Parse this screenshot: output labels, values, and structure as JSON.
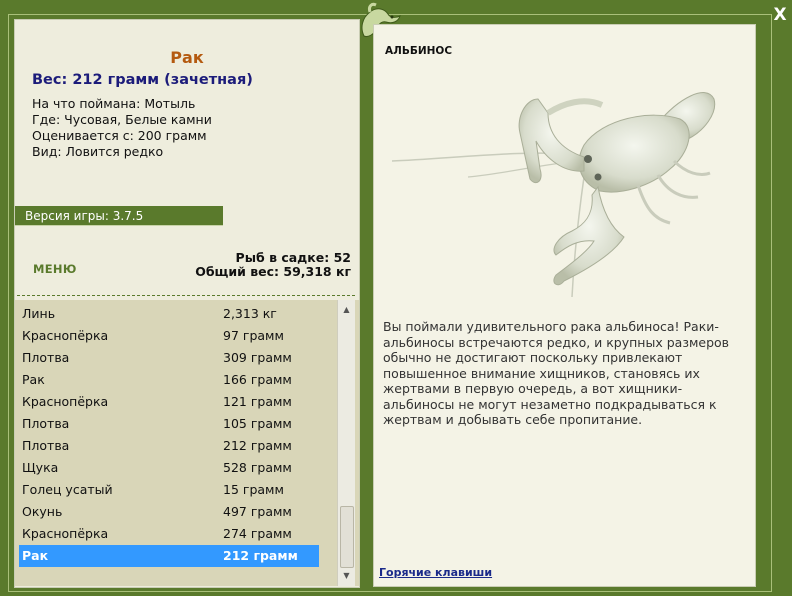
{
  "window": {
    "close_label": "X"
  },
  "catch": {
    "name": "Рак",
    "weight": "Вес: 212 грамм (зачетная)",
    "bait": "На что поймана: Мотыль",
    "place": "Где: Чусовая, Белые камни",
    "rated_from": "Оценивается с: 200 грамм",
    "kind": "Вид: Ловится редко"
  },
  "version": "Версия игры: 3.7.5",
  "menu_label": "МЕНЮ",
  "stats": {
    "fish_count": "Рыб в садке: 52",
    "total_weight": "Общий вес: 59,318 кг"
  },
  "fish_list": [
    {
      "name": "Линь",
      "weight": "2,313 кг"
    },
    {
      "name": "Краснопёрка",
      "weight": "97 грамм"
    },
    {
      "name": "Плотва",
      "weight": "309 грамм"
    },
    {
      "name": "Рак",
      "weight": "166 грамм"
    },
    {
      "name": "Краснопёрка",
      "weight": "121 грамм"
    },
    {
      "name": "Плотва",
      "weight": "105 грамм"
    },
    {
      "name": "Плотва",
      "weight": "212 грамм"
    },
    {
      "name": "Щука",
      "weight": "528 грамм"
    },
    {
      "name": "Голец усатый",
      "weight": "15 грамм"
    },
    {
      "name": "Окунь",
      "weight": "497 грамм"
    },
    {
      "name": "Краснопёрка",
      "weight": "274 грамм"
    },
    {
      "name": "Рак",
      "weight": "212 грамм",
      "selected": true
    }
  ],
  "detail": {
    "title": "АЛЬБИНОС",
    "description": "Вы поймали удивительного рака альбиноса! Раки-альбиносы встречаются редко, и крупных размеров обычно не достигают поскольку привлекают повышенное внимание хищников, становясь их жертвами в первую очередь, а вот хищники-альбиносы не могут незаметно подкрадываться к жертвам и добывать себе пропитание.",
    "hotkeys_label": "Горячие клавиши"
  },
  "colors": {
    "frame": "#5a7a2c",
    "title_orange": "#b45a10",
    "weight_blue": "#1c1c7a",
    "selected_row": "#3399ff",
    "list_bg": "#d9d6b8",
    "panel_bg": "#eeeddd"
  }
}
